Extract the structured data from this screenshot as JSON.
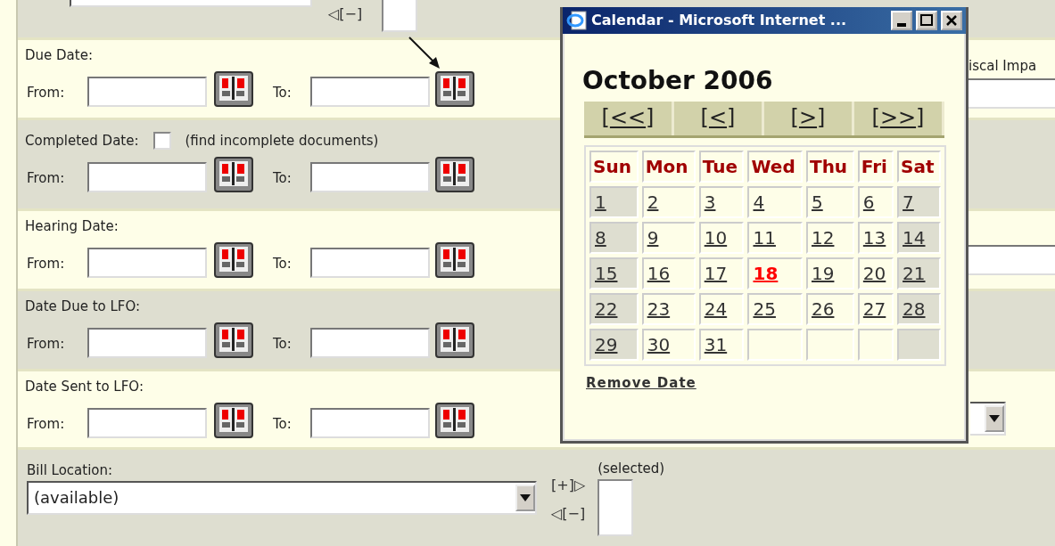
{
  "top_row": {
    "shaded": true,
    "remove_label": "◁[−]"
  },
  "date_filters": [
    {
      "label": "Due Date:",
      "shaded": false,
      "from_label": "From:",
      "to_label": "To:"
    },
    {
      "label": "Completed Date:",
      "shaded": true,
      "checkbox": {
        "label": "(find incomplete documents)",
        "checked": false
      },
      "from_label": "From:",
      "to_label": "To:"
    },
    {
      "label": "Hearing Date:",
      "shaded": false,
      "from_label": "From:",
      "to_label": "To:"
    },
    {
      "label": "Date Due to LFO:",
      "shaded": true,
      "from_label": "From:",
      "to_label": "To:"
    },
    {
      "label": "Date Sent to LFO:",
      "shaded": false,
      "from_label": "From:",
      "to_label": "To:"
    }
  ],
  "right_column": {
    "label": "iscal Impa"
  },
  "bill_location": {
    "label": "Bill Location:",
    "shaded": true,
    "value": "(available)",
    "add_label": "[+]▷",
    "remove_label": "◁[−]",
    "selected_label": "(selected)"
  },
  "calendar_popup": {
    "title": "Calendar - Microsoft Internet ...",
    "month": "October 2006",
    "nav": [
      {
        "open": "[",
        "arrows": "<<",
        "close": "]"
      },
      {
        "open": "[",
        "arrows": "<",
        "close": "]"
      },
      {
        "open": "[",
        "arrows": ">",
        "close": "]"
      },
      {
        "open": "[",
        "arrows": ">>",
        "close": "]"
      }
    ],
    "weekdays": [
      "Sun",
      "Mon",
      "Tue",
      "Wed",
      "Thu",
      "Fri",
      "Sat"
    ],
    "weeks": [
      [
        {
          "kind": "day",
          "day": "1",
          "weekend": true,
          "today": false
        },
        {
          "kind": "day",
          "day": "2",
          "weekend": false,
          "today": false
        },
        {
          "kind": "day",
          "day": "3",
          "weekend": false,
          "today": false
        },
        {
          "kind": "day",
          "day": "4",
          "weekend": false,
          "today": false
        },
        {
          "kind": "day",
          "day": "5",
          "weekend": false,
          "today": false
        },
        {
          "kind": "day",
          "day": "6",
          "weekend": false,
          "today": false
        },
        {
          "kind": "day",
          "day": "7",
          "weekend": true,
          "today": false
        }
      ],
      [
        {
          "kind": "day",
          "day": "8",
          "weekend": true,
          "today": false
        },
        {
          "kind": "day",
          "day": "9",
          "weekend": false,
          "today": false
        },
        {
          "kind": "day",
          "day": "10",
          "weekend": false,
          "today": false
        },
        {
          "kind": "day",
          "day": "11",
          "weekend": false,
          "today": false
        },
        {
          "kind": "day",
          "day": "12",
          "weekend": false,
          "today": false
        },
        {
          "kind": "day",
          "day": "13",
          "weekend": false,
          "today": false
        },
        {
          "kind": "day",
          "day": "14",
          "weekend": true,
          "today": false
        }
      ],
      [
        {
          "kind": "day",
          "day": "15",
          "weekend": true,
          "today": false
        },
        {
          "kind": "day",
          "day": "16",
          "weekend": false,
          "today": false
        },
        {
          "kind": "day",
          "day": "17",
          "weekend": false,
          "today": false
        },
        {
          "kind": "day",
          "day": "18",
          "weekend": false,
          "today": true
        },
        {
          "kind": "day",
          "day": "19",
          "weekend": false,
          "today": false
        },
        {
          "kind": "day",
          "day": "20",
          "weekend": false,
          "today": false
        },
        {
          "kind": "day",
          "day": "21",
          "weekend": true,
          "today": false
        }
      ],
      [
        {
          "kind": "day",
          "day": "22",
          "weekend": true,
          "today": false
        },
        {
          "kind": "day",
          "day": "23",
          "weekend": false,
          "today": false
        },
        {
          "kind": "day",
          "day": "24",
          "weekend": false,
          "today": false
        },
        {
          "kind": "day",
          "day": "25",
          "weekend": false,
          "today": false
        },
        {
          "kind": "day",
          "day": "26",
          "weekend": false,
          "today": false
        },
        {
          "kind": "day",
          "day": "27",
          "weekend": false,
          "today": false
        },
        {
          "kind": "day",
          "day": "28",
          "weekend": true,
          "today": false
        }
      ],
      [
        {
          "kind": "day",
          "day": "29",
          "weekend": true,
          "today": false
        },
        {
          "kind": "day",
          "day": "30",
          "weekend": false,
          "today": false
        },
        {
          "kind": "day",
          "day": "31",
          "weekend": false,
          "today": false
        },
        {
          "kind": "empty",
          "weekend": false
        },
        {
          "kind": "empty",
          "weekend": false
        },
        {
          "kind": "empty",
          "weekend": false
        },
        {
          "kind": "empty",
          "weekend": true
        }
      ]
    ],
    "remove_date": "Remove Date"
  }
}
